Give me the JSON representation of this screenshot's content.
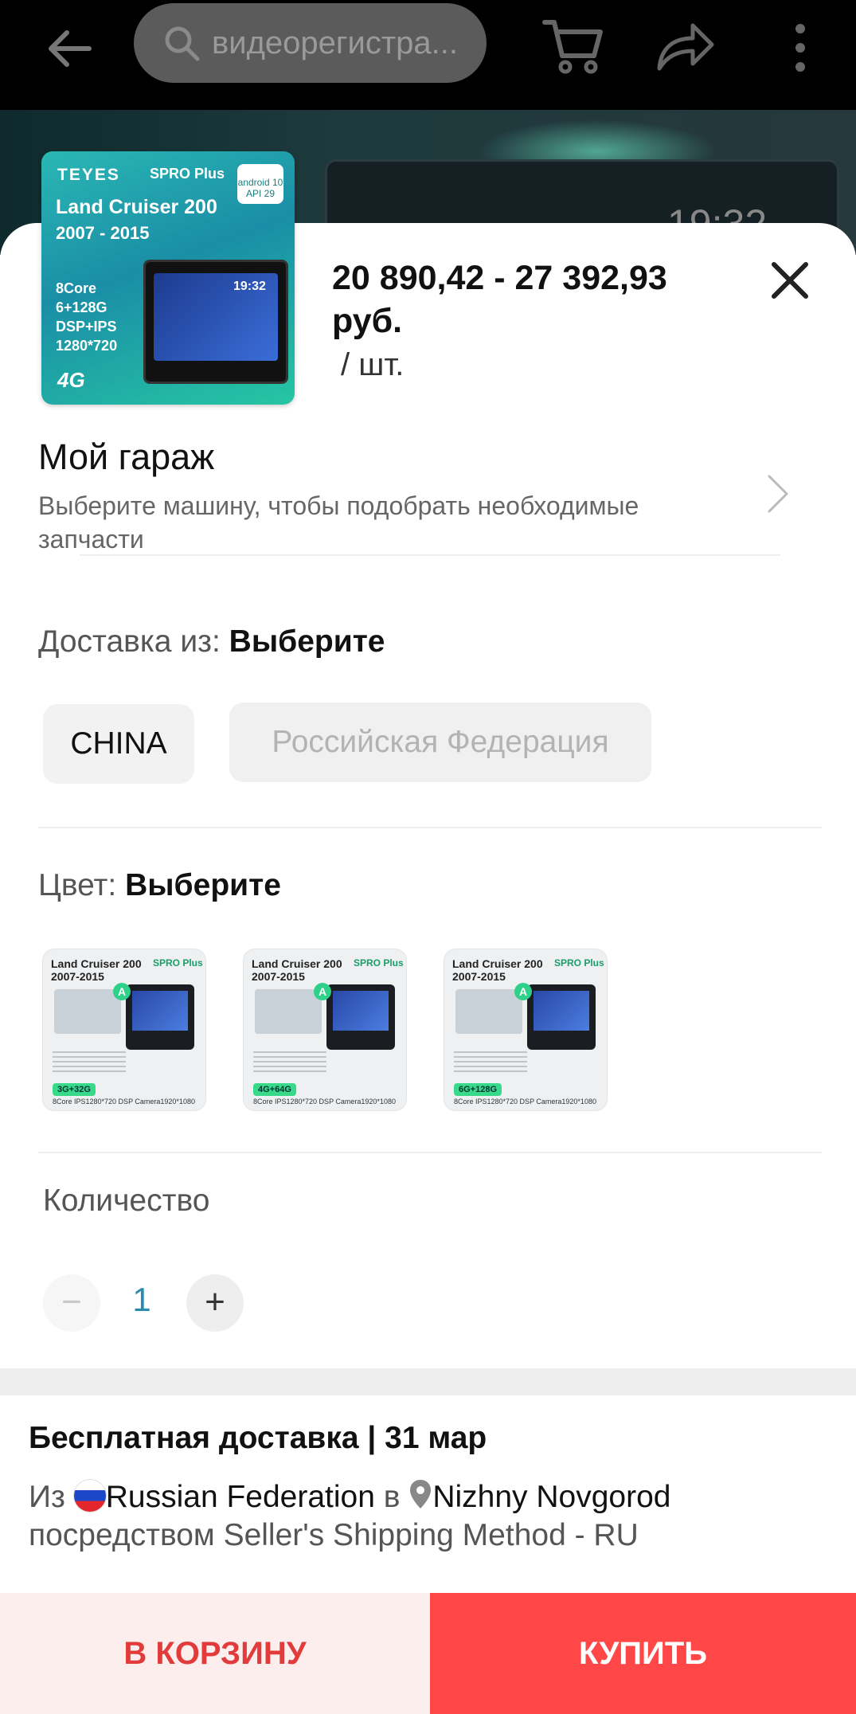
{
  "topbar": {
    "search_placeholder": "видеорегистра..."
  },
  "background": {
    "time": "19:32"
  },
  "product": {
    "thumb": {
      "brand": "TEYES",
      "line": "SPRO Plus",
      "android": "android 10",
      "api": "API 29",
      "model": "Land Cruiser 200",
      "years": "2007 - 2015",
      "specs": [
        "8Core",
        "6+128G",
        "DSP+IPS",
        "1280*720"
      ],
      "network": "4G",
      "clock": "19:32"
    },
    "price": "20 890,42 - 27 392,93 руб.",
    "unit": "/ шт."
  },
  "garage": {
    "title": "Мой гараж",
    "subtitle": "Выберите машину, чтобы подобрать необходимые запчасти"
  },
  "delivery": {
    "label": "Доставка из: ",
    "value": "Выберите",
    "options": [
      {
        "label": "CHINA",
        "enabled": true
      },
      {
        "label": "Российская Федерация",
        "enabled": false
      }
    ]
  },
  "color": {
    "label": "Цвет: ",
    "value": "Выберите",
    "variants": [
      {
        "title": "Land Cruiser 200\n2007-2015",
        "badge": "3G+32G",
        "specs": "8Core  IPS1280*720  DSP  Camera1920*1080"
      },
      {
        "title": "Land Cruiser 200\n2007-2015",
        "badge": "4G+64G",
        "specs": "8Core  IPS1280*720  DSP  Camera1920*1080"
      },
      {
        "title": "Land Cruiser 200\n2007-2015",
        "badge": "6G+128G",
        "specs": "8Core  IPS1280*720  DSP  Camera1920*1080"
      }
    ],
    "variant_line": "SPRO Plus"
  },
  "quantity": {
    "label": "Количество",
    "value": "1",
    "minus": "−",
    "plus": "+"
  },
  "shipping": {
    "title": "Бесплатная доставка | 31 мар",
    "from_prefix": "Из ",
    "from_country": "Russian Federation",
    "to_word": " в ",
    "to_city": "Nizhny Novgorod",
    "method": "посредством Seller's Shipping Method - RU"
  },
  "actions": {
    "cart": "В КОРЗИНУ",
    "buy": "КУПИТЬ"
  },
  "colors": {
    "accent": "#ff4747",
    "cart_bg": "#fdeeee",
    "cart_text": "#e23b3b",
    "qty_value": "#2a8ab0"
  },
  "icons": [
    "back-arrow-icon",
    "search-icon",
    "cart-icon",
    "share-icon",
    "more-vertical-icon",
    "close-icon",
    "chevron-right-icon",
    "russia-flag-icon",
    "location-pin-icon"
  ]
}
